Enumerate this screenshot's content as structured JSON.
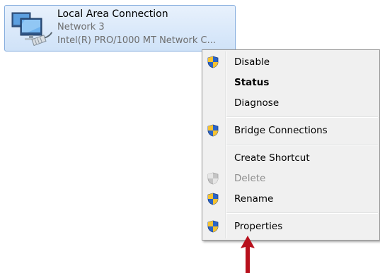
{
  "connection": {
    "title": "Local Area Connection",
    "network": "Network  3",
    "adapter": "Intel(R) PRO/1000 MT Network C...",
    "icon": "network-connection-icon"
  },
  "context_menu": {
    "items": [
      {
        "label": "Disable",
        "icon": "uac-shield-icon",
        "enabled": true,
        "bold": false
      },
      {
        "label": "Status",
        "icon": null,
        "enabled": true,
        "bold": true
      },
      {
        "label": "Diagnose",
        "icon": null,
        "enabled": true,
        "bold": false
      },
      {
        "label": "Bridge Connections",
        "icon": "uac-shield-icon",
        "enabled": true,
        "bold": false
      },
      {
        "label": "Create Shortcut",
        "icon": null,
        "enabled": true,
        "bold": false
      },
      {
        "label": "Delete",
        "icon": "uac-shield-icon",
        "enabled": false,
        "bold": false
      },
      {
        "label": "Rename",
        "icon": "uac-shield-icon",
        "enabled": true,
        "bold": false
      },
      {
        "label": "Properties",
        "icon": "uac-shield-icon",
        "enabled": true,
        "bold": false
      }
    ]
  },
  "annotation": {
    "icon": "red-arrow-icon",
    "color": "#b8101c"
  }
}
